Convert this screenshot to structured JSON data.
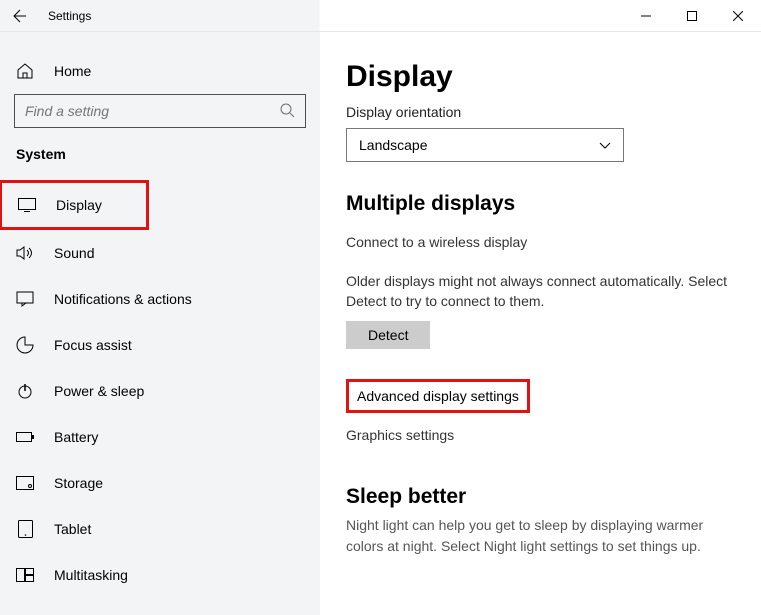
{
  "titlebar": {
    "title": "Settings"
  },
  "sidebar": {
    "home_label": "Home",
    "search_placeholder": "Find a setting",
    "category": "System",
    "items": [
      {
        "label": "Display"
      },
      {
        "label": "Sound"
      },
      {
        "label": "Notifications & actions"
      },
      {
        "label": "Focus assist"
      },
      {
        "label": "Power & sleep"
      },
      {
        "label": "Battery"
      },
      {
        "label": "Storage"
      },
      {
        "label": "Tablet"
      },
      {
        "label": "Multitasking"
      }
    ]
  },
  "main": {
    "page_title": "Display",
    "orientation": {
      "label": "Display orientation",
      "value": "Landscape"
    },
    "multiple": {
      "heading": "Multiple displays",
      "wireless_link": "Connect to a wireless display",
      "hint": "Older displays might not always connect automatically. Select Detect to try to connect to them.",
      "detect_label": "Detect",
      "advanced_link": "Advanced display settings",
      "graphics_link": "Graphics settings"
    },
    "sleep": {
      "heading": "Sleep better",
      "text": "Night light can help you get to sleep by displaying warmer colors at night. Select Night light settings to set things up."
    }
  }
}
